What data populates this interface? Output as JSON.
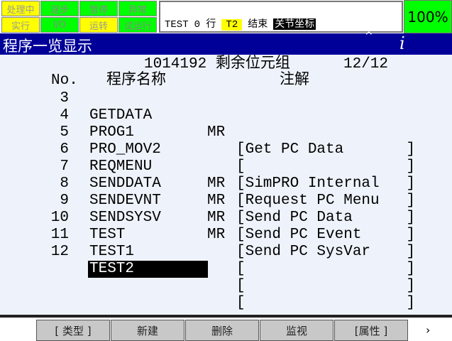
{
  "indicators": [
    {
      "label": "处理中",
      "on": true
    },
    {
      "label": "逐步",
      "on": false
    },
    {
      "label": "暂停",
      "on": false
    },
    {
      "label": "异常",
      "on": false
    },
    {
      "label": "实行",
      "on": true
    },
    {
      "label": "I/O",
      "on": false
    },
    {
      "label": "运转",
      "on": true
    },
    {
      "label": "试运行",
      "on": false
    }
  ],
  "status": {
    "program": "TEST",
    "line": "0 行",
    "mode": "T2",
    "state": "结束",
    "coord": "关节坐标"
  },
  "override": "100%",
  "title": "程序一览显示",
  "info_icon": "i",
  "header": {
    "memory": "1014192 剩余位元组",
    "page": "12/12",
    "col_no": "No.",
    "col_name": "程序名称",
    "col_comment": "注解"
  },
  "programs": [
    {
      "no": "3",
      "name": "GETDATA",
      "sub": "MR",
      "comment": "[Get PC Data       ]"
    },
    {
      "no": "4",
      "name": "PROG1",
      "sub": "",
      "comment": "[                  ]"
    },
    {
      "no": "5",
      "name": "PRO_MOV2",
      "sub": "",
      "comment": "[SimPRO Internal   ]"
    },
    {
      "no": "6",
      "name": "REQMENU",
      "sub": "MR",
      "comment": "[Request PC Menu   ]"
    },
    {
      "no": "7",
      "name": "SENDDATA",
      "sub": "MR",
      "comment": "[Send PC Data      ]"
    },
    {
      "no": "8",
      "name": "SENDEVNT",
      "sub": "MR",
      "comment": "[Send PC Event     ]"
    },
    {
      "no": "9",
      "name": "SENDSYSV",
      "sub": "MR",
      "comment": "[Send PC SysVar    ]"
    },
    {
      "no": "10",
      "name": "TEST",
      "sub": "",
      "comment": "[                  ]"
    },
    {
      "no": "11",
      "name": "TEST1",
      "sub": "",
      "comment": "[                  ]"
    },
    {
      "no": "12",
      "name": "TEST2",
      "sub": "",
      "comment": "[                  ]",
      "selected": true
    }
  ],
  "fkeys": [
    "[ 类型 ]",
    "新建",
    "删除",
    "监视",
    "[属性 ]"
  ],
  "next": "›"
}
